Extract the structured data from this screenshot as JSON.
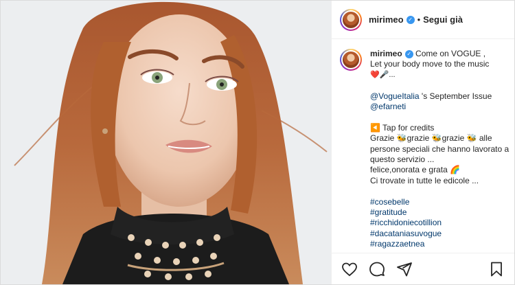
{
  "header": {
    "username": "mirimeo",
    "separator": "•",
    "follow_label": "Segui già"
  },
  "caption": {
    "username": "mirimeo",
    "lines": [
      "Come on VOGUE ,",
      "Let your body move to the music",
      "❤️🎤...",
      "",
      "@VogueItalia 's September Issue",
      "@efarneti",
      "",
      "◀️ Tap for credits",
      "Grazie 🐝grazie 🐝grazie 🐝 alle",
      "persone speciali che hanno lavorato a",
      "questo servizio ...",
      "felice,onorata e grata 🌈",
      "Ci trovate in tutte le edicole ...",
      "",
      "#cosebelle",
      "#gratitude",
      "#ricchidoniecotillion",
      "#dacataniasuvogue",
      "#ragazzaetnea"
    ],
    "mention_1": "@VogueItalia",
    "mention_1_rest": " 's September Issue",
    "mention_2": "@efarneti",
    "hashtags": [
      "#cosebelle",
      "#gratitude",
      "#ricchidoniecotillion",
      "#dacataniasuvogue",
      "#ragazzaetnea"
    ]
  },
  "icons": {
    "like": "heart-icon",
    "comment": "comment-icon",
    "share": "share-icon",
    "save": "bookmark-icon",
    "verified": "verified-badge-icon"
  },
  "colors": {
    "link": "#00376b",
    "verified": "#3897f0",
    "border": "#dbdbdb"
  }
}
